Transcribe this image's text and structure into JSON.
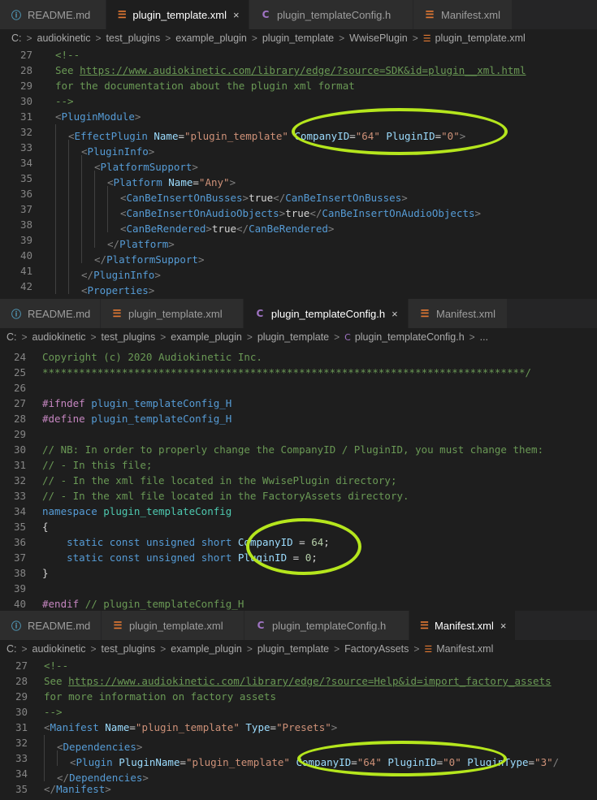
{
  "tabs": {
    "readme": "README.md",
    "plugin_xml": "plugin_template.xml",
    "config_h": "plugin_templateConfig.h",
    "manifest": "Manifest.xml",
    "close": "×"
  },
  "crumbs": {
    "c": "C:",
    "audiokinetic": "audiokinetic",
    "test_plugins": "test_plugins",
    "example_plugin": "example_plugin",
    "plugin_template": "plugin_template",
    "wwiseplugin": "WwisePlugin",
    "plugin_xml": "plugin_template.xml",
    "config_h": "plugin_templateConfig.h",
    "ellipsis": "...",
    "factoryassets": "FactoryAssets",
    "manifest": "Manifest.xml",
    "chev": ">"
  },
  "icons": {
    "info": "info-icon",
    "rss": "xml-file-icon",
    "c": "c-header-icon",
    "close": "close-icon",
    "highlight_color": "#b5e61d"
  },
  "pane1": {
    "lines": [
      {
        "n": "27"
      },
      {
        "n": "28"
      },
      {
        "n": "29"
      },
      {
        "n": "30"
      },
      {
        "n": "31"
      },
      {
        "n": "32"
      },
      {
        "n": "33"
      },
      {
        "n": "34"
      },
      {
        "n": "35"
      },
      {
        "n": "36"
      },
      {
        "n": "37"
      },
      {
        "n": "38"
      },
      {
        "n": "39"
      },
      {
        "n": "40"
      },
      {
        "n": "41"
      },
      {
        "n": "42"
      }
    ],
    "t": {
      "cmt_open": "<!--",
      "see": "See ",
      "url": "https://www.audiokinetic.com/library/edge/?source=SDK&id=plugin__xml.html",
      "for_doc": "for the documentation about the plugin xml format",
      "cmt_close": "-->",
      "plugin_module": "PluginModule",
      "effect_plugin": "EffectPlugin",
      "name": "Name",
      "name_val": "\"plugin_template\"",
      "company": "CompanyID",
      "company_val": "\"64\"",
      "plugin": "PluginID",
      "plugin_val": "\"0\"",
      "plugin_info": "PluginInfo",
      "platform_support": "PlatformSupport",
      "platform": "Platform",
      "any": "\"Any\"",
      "busses": "CanBeInsertOnBusses",
      "audio_objects": "CanBeInsertOnAudioObjects",
      "rendered": "CanBeRendered",
      "true": "true",
      "properties": "Properties"
    }
  },
  "pane2": {
    "lines": [
      {
        "n": "24"
      },
      {
        "n": "25"
      },
      {
        "n": "26"
      },
      {
        "n": "27"
      },
      {
        "n": "28"
      },
      {
        "n": "29"
      },
      {
        "n": "30"
      },
      {
        "n": "31"
      },
      {
        "n": "32"
      },
      {
        "n": "33"
      },
      {
        "n": "34"
      },
      {
        "n": "35"
      },
      {
        "n": "36"
      },
      {
        "n": "37"
      },
      {
        "n": "38"
      },
      {
        "n": "39"
      },
      {
        "n": "40"
      }
    ],
    "t": {
      "copyright": "Copyright (c) 2020 Audiokinetic Inc.",
      "stars": "*******************************************************************************/",
      "ifndef": "#ifndef",
      "define": "#define",
      "guard": "plugin_templateConfig_H",
      "nb": "// NB: In order to properly change the CompanyID / PluginID, you must change them:",
      "this_file": "// - In this file;",
      "xml_wwise": "// - In the xml file located in the WwisePlugin directory;",
      "xml_factory": "// - In the xml file located in the FactoryAssets directory.",
      "namespace": "namespace",
      "ns_name": "plugin_templateConfig",
      "brace_open": "{",
      "brace_close": "}",
      "static": "static",
      "const": "const",
      "unsigned": "unsigned",
      "short": "short",
      "company": "CompanyID",
      "plugin": "PluginID",
      "eq": " = ",
      "n64": "64",
      "n0": "0",
      "semi": ";",
      "endif": "#endif",
      "endif_cmt": "// plugin_templateConfig_H"
    }
  },
  "pane3": {
    "lines": [
      {
        "n": "27"
      },
      {
        "n": "28"
      },
      {
        "n": "29"
      },
      {
        "n": "30"
      },
      {
        "n": "31"
      },
      {
        "n": "32"
      },
      {
        "n": "33"
      },
      {
        "n": "34"
      },
      {
        "n": "35"
      }
    ],
    "t": {
      "cmt_open": "<!--",
      "see": "See ",
      "url": "https://www.audiokinetic.com/library/edge/?source=Help&id=import_factory_assets",
      "for_more": "for more information on factory assets",
      "cmt_close": "-->",
      "manifest": "Manifest",
      "name": "Name",
      "name_val": "\"plugin_template\"",
      "type": "Type",
      "type_val": "\"Presets\"",
      "dependencies": "Dependencies",
      "plugin": "Plugin",
      "plugin_name": "PluginName",
      "company": "CompanyID",
      "company_val": "\"64\"",
      "plugin_id": "PluginID",
      "plugin_val": "\"0\"",
      "plugin_type": "PluginType",
      "plugin_type_val": "\"3\"",
      "tail": "/"
    }
  }
}
